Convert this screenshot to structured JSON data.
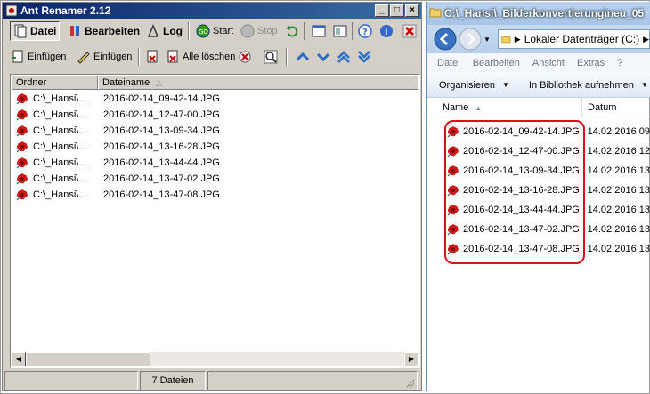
{
  "ant": {
    "title": "Ant Renamer 2.12",
    "toolbar1": {
      "datei": "Datei",
      "bearbeiten": "Bearbeiten",
      "log": "Log",
      "start": "Start",
      "stop": "Stop"
    },
    "toolbar2": {
      "einfuegen1": "Einfügen",
      "einfuegen2": "Einfügen",
      "alle_loeschen": "Alle löschen"
    },
    "columns": {
      "ordner": "Ordner",
      "dateiname": "Dateiname"
    },
    "rows": [
      {
        "ordner": "C:\\_Hansi\\...",
        "name": "2016-02-14_09-42-14.JPG"
      },
      {
        "ordner": "C:\\_Hansi\\...",
        "name": "2016-02-14_12-47-00.JPG"
      },
      {
        "ordner": "C:\\_Hansi\\...",
        "name": "2016-02-14_13-09-34.JPG"
      },
      {
        "ordner": "C:\\_Hansi\\...",
        "name": "2016-02-14_13-16-28.JPG"
      },
      {
        "ordner": "C:\\_Hansi\\...",
        "name": "2016-02-14_13-44-44.JPG"
      },
      {
        "ordner": "C:\\_Hansi\\...",
        "name": "2016-02-14_13-47-02.JPG"
      },
      {
        "ordner": "C:\\_Hansi\\...",
        "name": "2016-02-14_13-47-08.JPG"
      }
    ],
    "status": {
      "count": "7 Dateien"
    }
  },
  "explorer": {
    "title": "C:\\_Hansi\\_Bilderkonvertierung\\neu_05",
    "address": "Lokaler Datenträger (C:)",
    "menu": [
      "Datei",
      "Bearbeiten",
      "Ansicht",
      "Extras",
      "?"
    ],
    "commands": {
      "organisieren": "Organisieren",
      "bibliothek": "In Bibliothek aufnehmen"
    },
    "columns": {
      "name": "Name",
      "datum": "Datum"
    },
    "rows": [
      {
        "name": "2016-02-14_09-42-14.JPG",
        "datum": "14.02.2016 09"
      },
      {
        "name": "2016-02-14_12-47-00.JPG",
        "datum": "14.02.2016 12"
      },
      {
        "name": "2016-02-14_13-09-34.JPG",
        "datum": "14.02.2016 13"
      },
      {
        "name": "2016-02-14_13-16-28.JPG",
        "datum": "14.02.2016 13"
      },
      {
        "name": "2016-02-14_13-44-44.JPG",
        "datum": "14.02.2016 13"
      },
      {
        "name": "2016-02-14_13-47-02.JPG",
        "datum": "14.02.2016 13"
      },
      {
        "name": "2016-02-14_13-47-08.JPG",
        "datum": "14.02.2016 13"
      }
    ]
  },
  "colors": {
    "titlebar": "#0a246a",
    "highlight": "#d8101a",
    "file_icon": "#d01818"
  }
}
